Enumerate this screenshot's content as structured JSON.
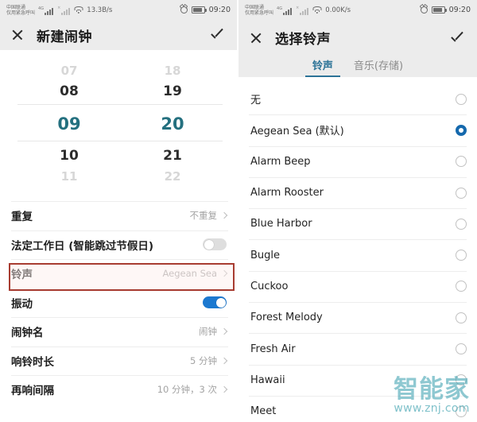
{
  "left": {
    "status": {
      "carrier_line1": "中国联通",
      "carrier_line2": "仅用紧急呼叫",
      "network_label": "4G",
      "data_rate": "13.3B/s",
      "time": "09:20"
    },
    "header": {
      "title": "新建闹钟",
      "close_icon": "close-icon",
      "confirm_icon": "check-icon"
    },
    "picker": {
      "hours": [
        "07",
        "08",
        "09",
        "10",
        "11"
      ],
      "minutes": [
        "18",
        "19",
        "20",
        "21",
        "22"
      ],
      "selected_hour": "09",
      "selected_minute": "20"
    },
    "settings": [
      {
        "label": "重复",
        "value": "不重复",
        "control": "chevron"
      },
      {
        "label": "法定工作日 (智能跳过节假日)",
        "value": "",
        "control": "toggle",
        "toggle_on": false
      },
      {
        "label": "铃声",
        "value": "Aegean Sea",
        "control": "chevron",
        "highlighted": true
      },
      {
        "label": "振动",
        "value": "",
        "control": "toggle",
        "toggle_on": true
      },
      {
        "label": "闹钟名",
        "value": "闹钟",
        "control": "chevron"
      },
      {
        "label": "响铃时长",
        "value": "5 分钟",
        "control": "chevron"
      },
      {
        "label": "再响间隔",
        "value": "10 分钟，3 次",
        "control": "chevron"
      }
    ]
  },
  "right": {
    "status": {
      "carrier_line1": "中国联通",
      "carrier_line2": "仅用紧急呼叫",
      "network_label": "4G",
      "data_rate": "0.00K/s",
      "time": "09:20"
    },
    "header": {
      "title": "选择铃声",
      "close_icon": "close-icon",
      "confirm_icon": "check-icon"
    },
    "tabs": [
      {
        "label": "铃声",
        "selected": true
      },
      {
        "label": "音乐(存储)",
        "selected": false
      }
    ],
    "ringtones": [
      {
        "name": "无",
        "selected": false
      },
      {
        "name": "Aegean Sea (默认)",
        "selected": true
      },
      {
        "name": "Alarm Beep",
        "selected": false
      },
      {
        "name": "Alarm Rooster",
        "selected": false
      },
      {
        "name": "Blue Harbor",
        "selected": false
      },
      {
        "name": "Bugle",
        "selected": false
      },
      {
        "name": "Cuckoo",
        "selected": false
      },
      {
        "name": "Forest Melody",
        "selected": false
      },
      {
        "name": "Fresh Air",
        "selected": false
      },
      {
        "name": "Hawaii",
        "selected": false
      },
      {
        "name": "Meet",
        "selected": false
      }
    ]
  },
  "watermark": {
    "brand": "智能家",
    "url": "www.znj.com"
  },
  "colors": {
    "picker_selected": "#24707f",
    "tab_selected": "#2c7397",
    "toggle_on": "#1c79d0",
    "radio_selected": "#1569ad",
    "highlight_border": "#a83c31",
    "watermark": "#48a6b4",
    "header_bg": "#ececec"
  }
}
